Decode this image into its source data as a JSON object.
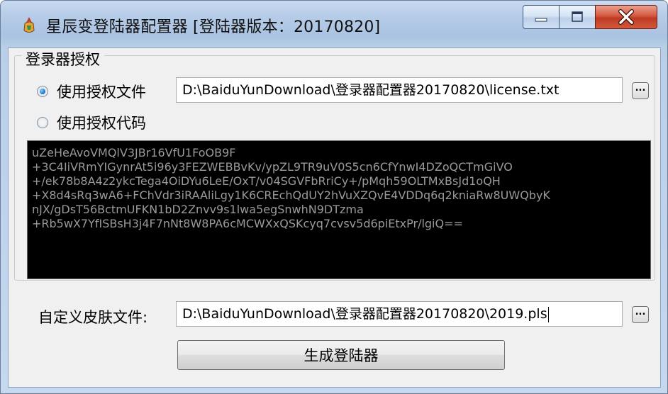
{
  "window": {
    "title": "星辰变登陆器配置器 [登陆器版本：20170820]"
  },
  "auth_group": {
    "title": "登录器授权",
    "option_file_label": "使用授权文件",
    "option_code_label": "使用授权代码",
    "selected": "file",
    "license_path": "D:\\BaiduYunDownload\\登录器配置器20170820\\license.txt",
    "browse_label": "...",
    "code_lines": [
      "uZeHeAvoVMQlV3JBr16VfU1FoOB9F",
      "+3C4IiVRmYIGynrAt5i96y3FEZWEBBvKv/ypZL9TR9uV0S5cn6CfYnwI4DZoQCTmGiVO",
      "+/ek78b8A4z2ykcTega4OiDYu6LeE/OxT/v04SGVFbRriCy+/pMqh59OLTMxBsJd1oQH",
      "+X8d4sRq3wA6+FChVdr3iRAAliLgy1K6CREchQdUY2hVuXZQvE4VDDq6q2kniaRw8UWQbyK",
      "nJX/gDsT56BctmUFKN1bD2Znvv9s1lwa5egSnwhN9DTzma",
      "+Rb5wX7YfISBsH3j4F7nNt8W8PA6cMCWXxQSKcyq7cvsv5d6piEtxPr/lgiQ=="
    ]
  },
  "skin": {
    "label": "自定义皮肤文件:",
    "path": "D:\\BaiduYunDownload\\登录器配置器20170820\\2019.pls",
    "browse_label": "..."
  },
  "generate_button": {
    "label": "生成登陆器"
  },
  "colors": {
    "titlebar": "#b7cde8",
    "close": "#c9432a",
    "client_bg": "#f0f0f0",
    "code_bg": "#000000",
    "code_text": "#9a9a9a"
  }
}
